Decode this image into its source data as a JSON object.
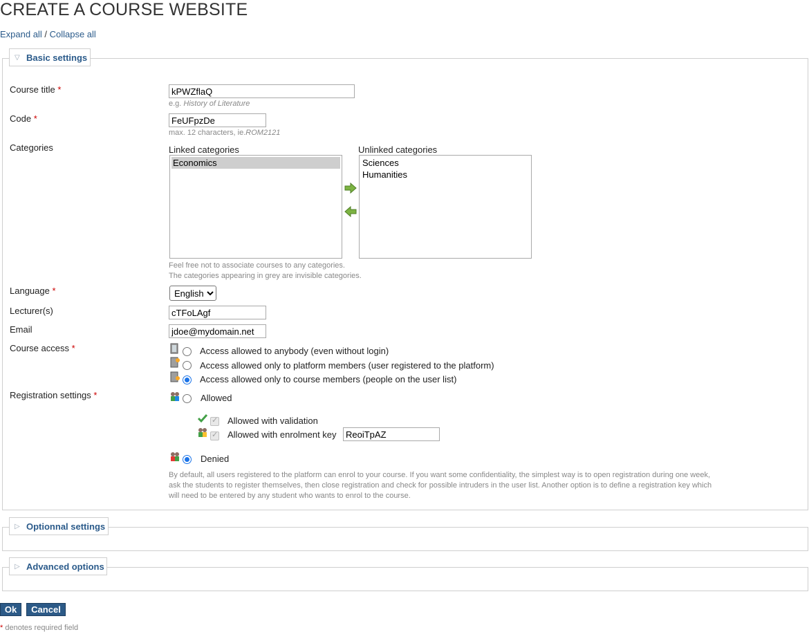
{
  "page": {
    "title": "CREATE A COURSE WEBSITE"
  },
  "expand": {
    "expand_all": "Expand all",
    "separator": "/",
    "collapse_all": "Collapse all"
  },
  "basic": {
    "legend": "Basic settings",
    "course_title": {
      "label": "Course title",
      "value": "kPWZflaQ",
      "hint_prefix": "e.g.",
      "hint_example": "History of Literature"
    },
    "code": {
      "label": "Code",
      "value": "FeUFpzDe",
      "hint_prefix": "max. 12 characters, ie.",
      "hint_example": "ROM2121"
    },
    "categories": {
      "label": "Categories",
      "linked_label": "Linked categories",
      "unlinked_label": "Unlinked categories",
      "linked": [
        "Economics"
      ],
      "unlinked": [
        "Sciences",
        "Humanities"
      ],
      "hint1": "Feel free not to associate courses to any categories.",
      "hint2": "The categories appearing in grey are invisible categories."
    },
    "language": {
      "label": "Language",
      "value": "English"
    },
    "lecturers": {
      "label": "Lecturer(s)",
      "value": "cTFoLAgf"
    },
    "email": {
      "label": "Email",
      "value": "jdoe@mydomain.net"
    },
    "course_access": {
      "label": "Course access",
      "options": [
        "Access allowed to anybody (even without login)",
        "Access allowed only to platform members (user registered to the platform)",
        "Access allowed only to course members (people on the user list)"
      ],
      "selected": 2
    },
    "registration": {
      "label": "Registration settings",
      "allowed": "Allowed",
      "with_validation": "Allowed with validation",
      "with_key": "Allowed with enrolment key",
      "key_value": "ReoiTpAZ",
      "denied": "Denied",
      "selected": "denied",
      "note": "By default, all users registered to the platform can enrol to your course. If you want some confidentiality, the simplest way is to open registration during one week, ask the students to register themselves, then close registration and check for possible intruders in the user list. Another option is to define a registration key which will need to be entered by any student who wants to enrol to the course."
    }
  },
  "optional": {
    "legend": "Optionnal settings"
  },
  "advanced": {
    "legend": "Advanced options"
  },
  "buttons": {
    "ok": "Ok",
    "cancel": "Cancel"
  },
  "footer": {
    "star": "*",
    "text": "denotes required field"
  },
  "required_mark": "*",
  "colors": {
    "link": "#2a5a8a",
    "button": "#2c5a87",
    "required": "#cc0000",
    "hint": "#888888"
  }
}
